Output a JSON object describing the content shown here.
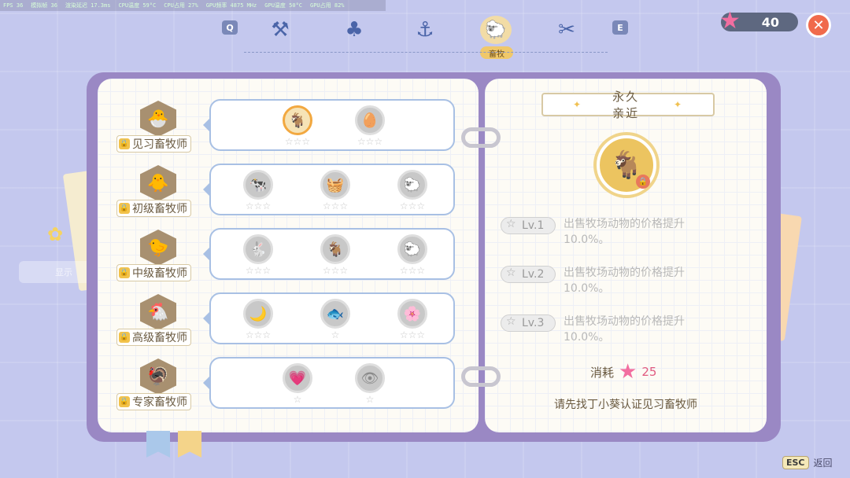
{
  "stats": [
    "FPS 36",
    "模拟帧 36",
    "渲染延迟 17.3ms",
    "CPU温度 59°C",
    "CPU占用 27%",
    "GPU频率 4875 MHz",
    "GPU温度 50°C",
    "GPU占用 82%"
  ],
  "tabs": {
    "left_key": "Q",
    "right_key": "E",
    "items": [
      {
        "icon": "hammer-icon",
        "glyph": "⚒"
      },
      {
        "icon": "sprout-icon",
        "glyph": "♣"
      },
      {
        "icon": "fishing-rod-icon",
        "glyph": "⚓"
      },
      {
        "icon": "sheep-icon",
        "glyph": "🐑",
        "active": true
      },
      {
        "icon": "scissors-icon",
        "glyph": "✂"
      }
    ],
    "active_label": "畜牧"
  },
  "currency": {
    "value": "40"
  },
  "side_tip": "显示",
  "ranks": [
    {
      "name": "见习畜牧师",
      "badge": "🐣",
      "skills": [
        {
          "glyph": "🐐",
          "stars": 3,
          "selected": true
        },
        {
          "glyph": "🥚",
          "stars": 3
        }
      ]
    },
    {
      "name": "初级畜牧师",
      "badge": "🐥",
      "skills": [
        {
          "glyph": "🐄",
          "stars": 3
        },
        {
          "glyph": "🧺",
          "stars": 3
        },
        {
          "glyph": "🐑",
          "stars": 3
        }
      ]
    },
    {
      "name": "中级畜牧师",
      "badge": "🐤",
      "skills": [
        {
          "glyph": "🐇",
          "stars": 3
        },
        {
          "glyph": "🐐",
          "stars": 3
        },
        {
          "glyph": "🐑",
          "stars": 3
        }
      ]
    },
    {
      "name": "高级畜牧师",
      "badge": "🐔",
      "skills": [
        {
          "glyph": "🌙",
          "stars": 3
        },
        {
          "glyph": "🐟",
          "stars": 1
        },
        {
          "glyph": "🌸",
          "stars": 3
        }
      ]
    },
    {
      "name": "专家畜牧师",
      "badge": "🦃",
      "skills": [
        {
          "glyph": "💗",
          "stars": 1
        },
        {
          "glyph": "👁",
          "stars": 1
        }
      ]
    }
  ],
  "detail": {
    "title": "永久亲近",
    "icon_glyph": "🐐",
    "levels": [
      {
        "label": "Lv.1",
        "desc": "出售牧场动物的价格提升10.0%。"
      },
      {
        "label": "Lv.2",
        "desc": "出售牧场动物的价格提升10.0%。"
      },
      {
        "label": "Lv.3",
        "desc": "出售牧场动物的价格提升10.0%。"
      }
    ],
    "cost_label": "消耗",
    "cost_value": "25",
    "hint": "请先找丁小葵认证见习畜牧师"
  },
  "footer": {
    "esc_key": "ESC",
    "esc_label": "返回"
  },
  "colors": {
    "background": "#c4c8ee",
    "book": "#9a88c4",
    "card_border": "#a8c0e4",
    "accent_pink": "#f26ea0",
    "close": "#f06a4c"
  }
}
